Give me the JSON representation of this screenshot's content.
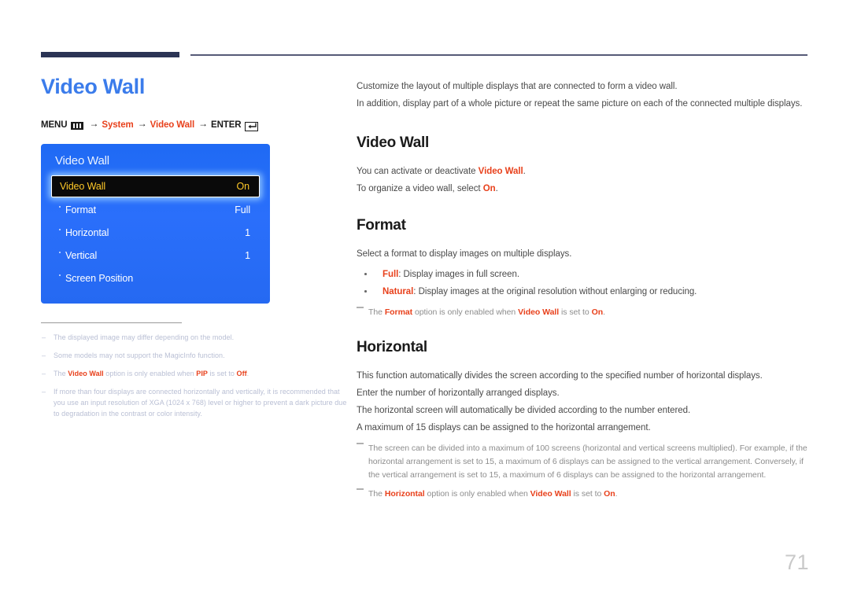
{
  "header": {
    "rule_color_thick": "#2b3455",
    "rule_color_thin": "#565a77"
  },
  "left": {
    "page_title": "Video Wall",
    "breadcrumb": {
      "menu_label": "MENU",
      "menu_icon": "menu-bars-icon",
      "arrow": "→",
      "step1": "System",
      "step2": "Video Wall",
      "enter_label": "ENTER",
      "enter_icon": "enter-key-icon"
    },
    "osd": {
      "title": "Video Wall",
      "rows": [
        {
          "label": "Video Wall",
          "value": "On",
          "selected": true,
          "bullet": false
        },
        {
          "label": "Format",
          "value": "Full",
          "selected": false,
          "bullet": true
        },
        {
          "label": "Horizontal",
          "value": "1",
          "selected": false,
          "bullet": true
        },
        {
          "label": "Vertical",
          "value": "1",
          "selected": false,
          "bullet": true
        },
        {
          "label": "Screen Position",
          "value": "",
          "selected": false,
          "bullet": true
        }
      ]
    },
    "notes": [
      {
        "dash": "–",
        "parts": [
          {
            "t": "The displayed image may differ depending on the model.",
            "hl": false
          }
        ]
      },
      {
        "dash": "–",
        "parts": [
          {
            "t": "Some models may not support the MagicInfo function.",
            "hl": false
          }
        ]
      },
      {
        "dash": "–",
        "parts": [
          {
            "t": "The ",
            "hl": false
          },
          {
            "t": "Video Wall",
            "hl": true
          },
          {
            "t": " option is only enabled when ",
            "hl": false
          },
          {
            "t": "PIP",
            "hl": true
          },
          {
            "t": " is set to ",
            "hl": false
          },
          {
            "t": "Off",
            "hl": true
          },
          {
            "t": ".",
            "hl": false
          }
        ]
      },
      {
        "dash": "–",
        "parts": [
          {
            "t": "If more than four displays are connected horizontally and vertically, it is recommended that you use an input resolution of XGA (1024 x 768) level or higher to prevent a dark picture due to degradation in the contrast or color intensity.",
            "hl": false
          }
        ]
      }
    ]
  },
  "right": {
    "intro": [
      "Customize the layout of multiple displays that are connected to form a video wall.",
      "In addition, display part of a whole picture or repeat the same picture on each of the connected multiple displays."
    ],
    "sections": [
      {
        "heading": "Video Wall",
        "paragraphs": [
          [
            {
              "t": "You can activate or deactivate ",
              "hl": false
            },
            {
              "t": "Video Wall",
              "hl": true
            },
            {
              "t": ".",
              "hl": false
            }
          ],
          [
            {
              "t": "To organize a video wall, select ",
              "hl": false
            },
            {
              "t": "On",
              "hl": true
            },
            {
              "t": ".",
              "hl": false
            }
          ]
        ],
        "bullets": [],
        "subnotes": []
      },
      {
        "heading": "Format",
        "paragraphs": [
          [
            {
              "t": "Select a format to display images on multiple displays.",
              "hl": false
            }
          ]
        ],
        "bullets": [
          [
            {
              "t": "Full",
              "hl": true
            },
            {
              "t": ": Display images in full screen.",
              "hl": false
            }
          ],
          [
            {
              "t": "Natural",
              "hl": true
            },
            {
              "t": ": Display images at the original resolution without enlarging or reducing.",
              "hl": false
            }
          ]
        ],
        "subnotes": [
          [
            {
              "t": "The ",
              "hl": false
            },
            {
              "t": "Format",
              "hl": true
            },
            {
              "t": " option is only enabled when ",
              "hl": false
            },
            {
              "t": "Video Wall",
              "hl": true
            },
            {
              "t": " is set to ",
              "hl": false
            },
            {
              "t": "On",
              "hl": true
            },
            {
              "t": ".",
              "hl": false
            }
          ]
        ]
      },
      {
        "heading": "Horizontal",
        "paragraphs": [
          [
            {
              "t": "This function automatically divides the screen according to the specified number of horizontal displays.",
              "hl": false
            }
          ],
          [
            {
              "t": "Enter the number of horizontally arranged displays.",
              "hl": false
            }
          ],
          [
            {
              "t": "The horizontal screen will automatically be divided according to the number entered.",
              "hl": false
            }
          ],
          [
            {
              "t": "A maximum of 15 displays can be assigned to the horizontal arrangement.",
              "hl": false
            }
          ]
        ],
        "bullets": [],
        "subnotes": [
          [
            {
              "t": "The screen can be divided into a maximum of 100 screens (horizontal and vertical screens multiplied). For example, if the horizontal arrangement is set to 15, a maximum of 6 displays can be assigned to the vertical arrangement. Conversely, if the vertical arrangement is set to 15, a maximum of 6 displays can be assigned to the horizontal arrangement.",
              "hl": false
            }
          ],
          [
            {
              "t": "The ",
              "hl": false
            },
            {
              "t": "Horizontal",
              "hl": true
            },
            {
              "t": " option is only enabled when ",
              "hl": false
            },
            {
              "t": "Video Wall",
              "hl": true
            },
            {
              "t": " is set to ",
              "hl": false
            },
            {
              "t": "On",
              "hl": true
            },
            {
              "t": ".",
              "hl": false
            }
          ]
        ]
      }
    ]
  },
  "page_number": "71"
}
